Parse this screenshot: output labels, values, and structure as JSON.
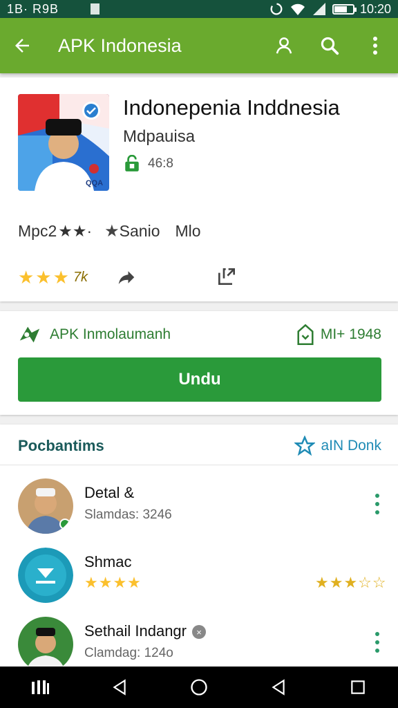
{
  "status_bar": {
    "left_text": "1B· R9B",
    "time": "10:20",
    "battery_level": 0.7
  },
  "app_bar": {
    "title": "APK Indonesia",
    "back_icon": "arrow-left-icon",
    "actions": [
      "account-icon",
      "search-icon",
      "more-vert-icon"
    ]
  },
  "app_info": {
    "title": "Indonepenia Inddnesia",
    "developer": "Mdpauisa",
    "size": "46:8",
    "rating_line": {
      "label": "Mpc2",
      "stars": "★★·",
      "category": "Sanio",
      "extra": "Mlo"
    },
    "stars": "★★★",
    "rating_count": "7k"
  },
  "apk_section": {
    "label": "APK Inmolaumanh",
    "version": "MI+ 1948",
    "download_label": "Undu"
  },
  "related": {
    "heading": "Pocbantims",
    "more_label": "aIN Donk",
    "items": [
      {
        "name": "Detal &",
        "sub": "Slamdas: 3246",
        "has_menu": true
      },
      {
        "name": "Shmac",
        "left_stars": "★★★★",
        "right_stars": "★★★☆☆"
      },
      {
        "name": "Sethail Indangr",
        "badge": "×",
        "sub": "Clamdag: 124o",
        "has_menu": true
      }
    ]
  },
  "colors": {
    "status_bar": "#15523c",
    "app_bar": "#6aaa2e",
    "download_button": "#2a9a3a",
    "accent_green": "#2e7d32",
    "star": "#fbc02d",
    "link_blue": "#1f8bb5"
  },
  "nav_bar": [
    "recents-icon",
    "back-triangle-icon",
    "home-circle-icon",
    "back-triangle-icon",
    "overview-square-icon"
  ]
}
